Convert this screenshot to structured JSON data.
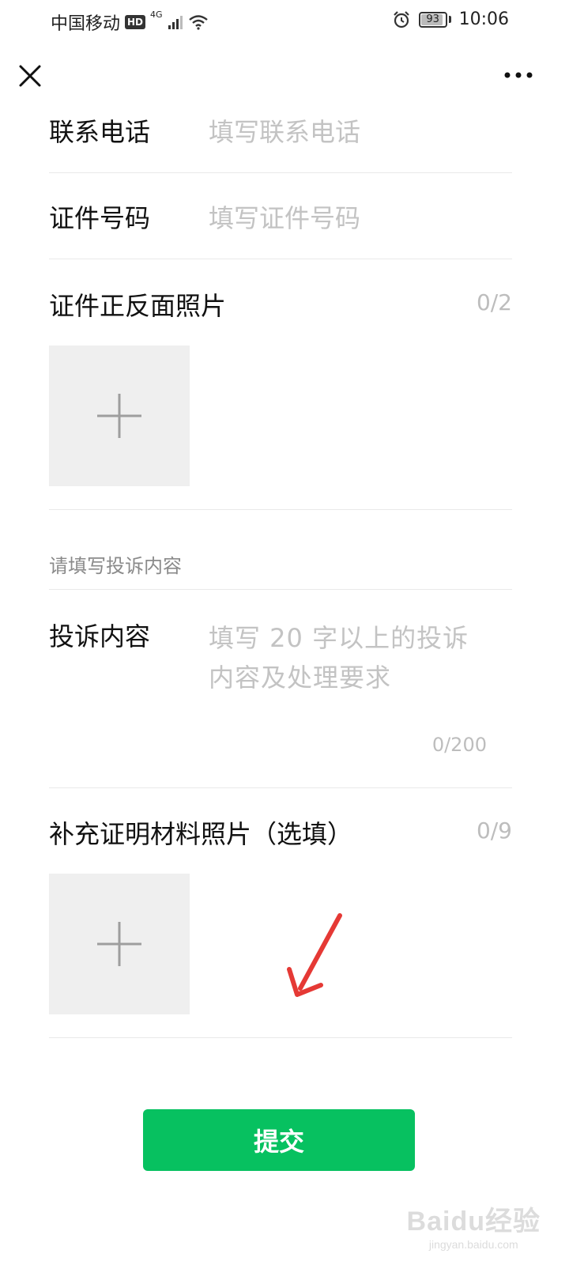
{
  "status_bar": {
    "carrier": "中国移动",
    "hd": "HD",
    "network": "4G",
    "battery": "93",
    "battery_level": 0.93,
    "time": "10:06"
  },
  "form": {
    "phone": {
      "label": "联系电话",
      "placeholder": "填写联系电话"
    },
    "id_number": {
      "label": "证件号码",
      "placeholder": "填写证件号码"
    },
    "id_photos": {
      "label": "证件正反面照片",
      "counter": "0/2"
    },
    "complaint_section_title": "请填写投诉内容",
    "complaint": {
      "label": "投诉内容",
      "placeholder": "填写 20 字以上的投诉内容及处理要求",
      "counter": "0/200"
    },
    "evidence_photos": {
      "label": "补充证明材料照片（选填）",
      "counter": "0/9"
    }
  },
  "submit_label": "提交",
  "watermark": {
    "main": "Baidu经验",
    "sub": "jingyan.baidu.com"
  },
  "colors": {
    "accent": "#07c160",
    "annotation_arrow": "#e53935"
  }
}
